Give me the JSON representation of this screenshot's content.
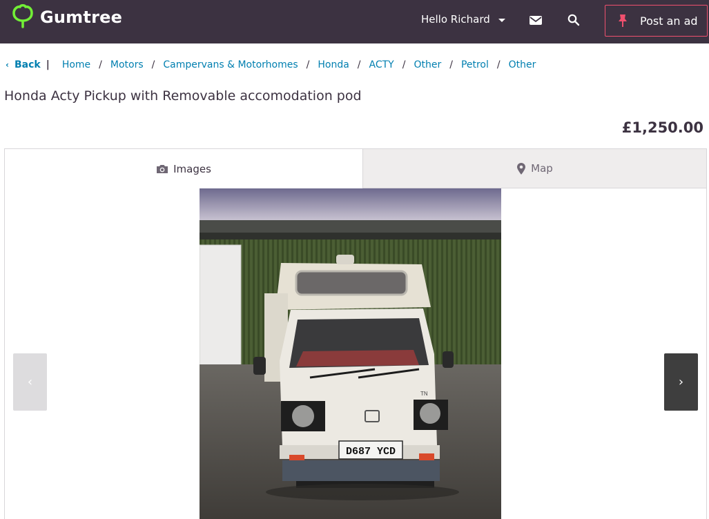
{
  "header": {
    "logo_text": "Gumtree",
    "greeting": "Hello Richard",
    "post_ad_label": "Post an ad",
    "brand_color": "#72ef36",
    "accent_color": "#f0506e",
    "background_color": "#3c3241"
  },
  "breadcrumb": {
    "back_label": "Back",
    "items": [
      "Home",
      "Motors",
      "Campervans & Motorhomes",
      "Honda",
      "ACTY",
      "Other",
      "Petrol",
      "Other"
    ]
  },
  "listing": {
    "title": "Honda Acty Pickup with Removable accomodation pod",
    "price": "£1,250.00"
  },
  "tabs": {
    "images_label": "Images",
    "map_label": "Map",
    "active": "Images"
  },
  "gallery": {
    "prev_symbol": "‹",
    "next_symbol": "›",
    "plate_text": "D687 YCD",
    "badge_text": "TN"
  }
}
